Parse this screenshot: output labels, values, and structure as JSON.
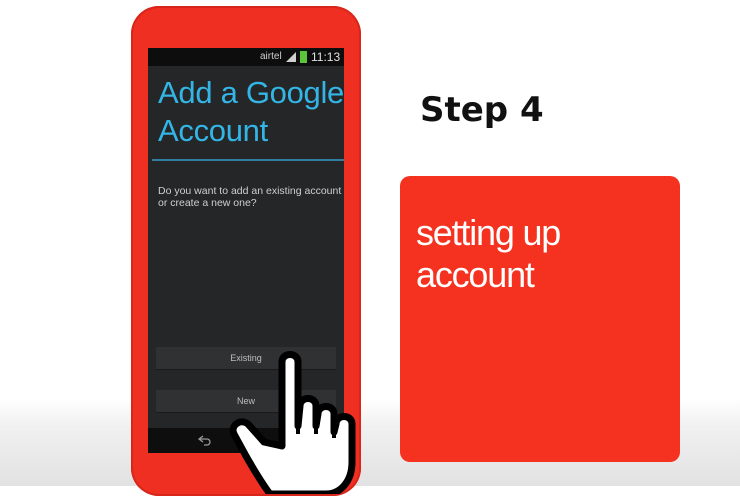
{
  "status_bar": {
    "carrier": "airtel",
    "time": "11:13",
    "icons": [
      "signal-icon",
      "battery-icon"
    ]
  },
  "screen": {
    "title_line1": "Add a Google",
    "title_line2": "Account",
    "question": "Do you want to add an existing account or create a new one?",
    "buttons": {
      "existing": "Existing",
      "new": "New"
    },
    "nav_icons": [
      "back-icon",
      "home-icon"
    ]
  },
  "step_label": "Step 4",
  "card_text": "setting up account",
  "colors": {
    "phone_red": "#ee2f22",
    "card_red": "#f5321f",
    "holo_blue": "#33b5e5",
    "screen_bg": "#252628"
  }
}
